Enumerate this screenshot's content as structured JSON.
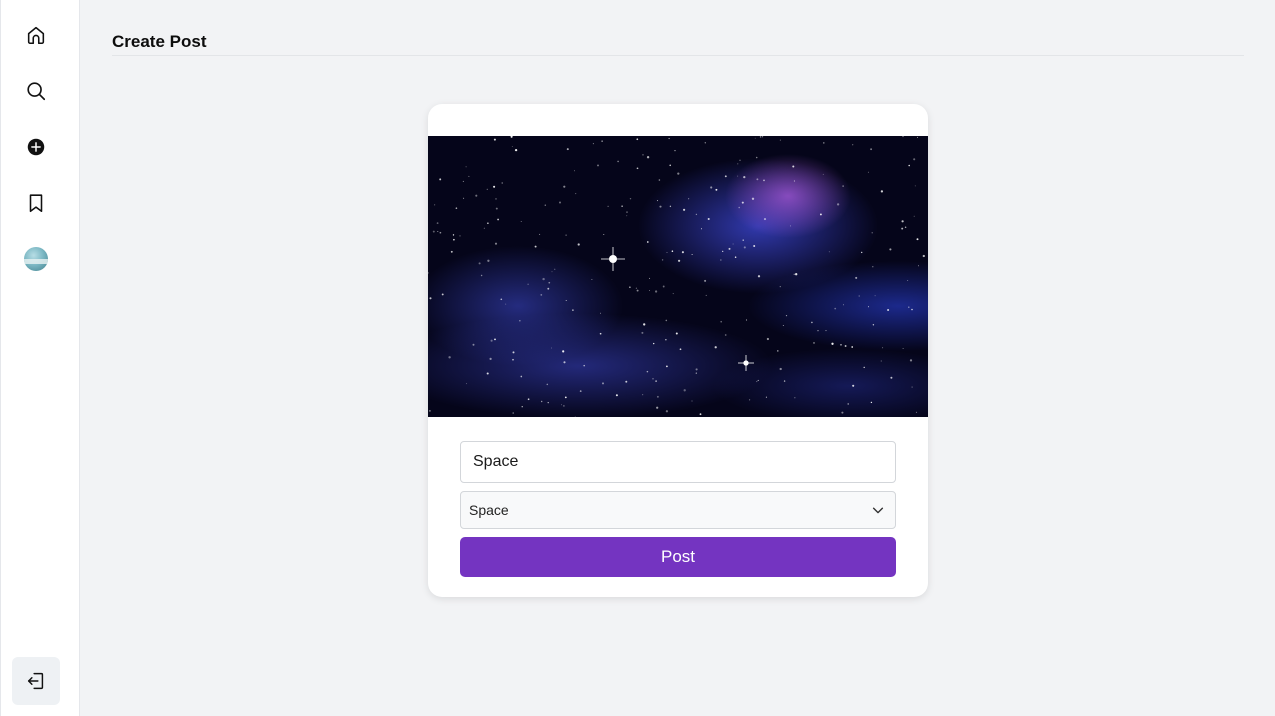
{
  "header": {
    "title": "Create Post"
  },
  "sidebar": {
    "items": [
      {
        "name": "home",
        "icon": "home-icon"
      },
      {
        "name": "search",
        "icon": "search-icon"
      },
      {
        "name": "create",
        "icon": "plus-circle-icon"
      },
      {
        "name": "saved",
        "icon": "bookmark-icon"
      },
      {
        "name": "profile",
        "icon": "avatar"
      }
    ],
    "logout_icon": "logout-icon"
  },
  "form": {
    "title_value": "Space",
    "category_selected": "Space",
    "submit_label": "Post"
  },
  "colors": {
    "accent": "#7434c1",
    "background": "#f2f3f5",
    "card": "#ffffff"
  }
}
